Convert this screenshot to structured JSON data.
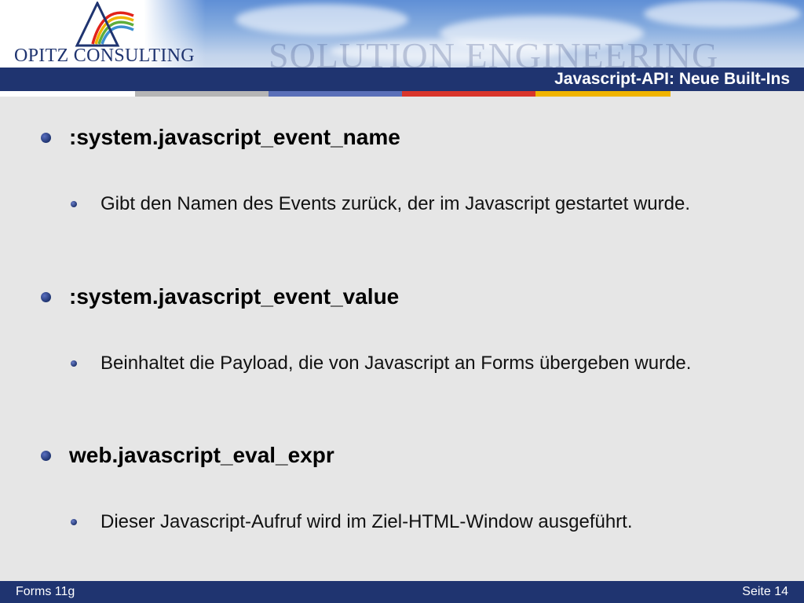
{
  "header": {
    "company_name": "OPITZ CONSULTING",
    "banner_text": "SOLUTION ENGINEERING",
    "slide_title": "Javascript-API: Neue Built-Ins"
  },
  "accent_colors": [
    "#1f3470",
    "#b5b5b5",
    "#5a6fb8",
    "#d9352b",
    "#f0b400"
  ],
  "content": {
    "items": [
      {
        "heading": ":system.javascript_event_name",
        "detail": "Gibt den Namen des Events zurück, der im Javascript gestartet wurde."
      },
      {
        "heading": ":system.javascript_event_value",
        "detail": "Beinhaltet die Payload, die von Javascript an Forms übergeben wurde."
      },
      {
        "heading": "web.javascript_eval_expr",
        "detail": "Dieser Javascript-Aufruf wird im Ziel-HTML-Window ausgeführt."
      }
    ]
  },
  "footer": {
    "left": "Forms 11g",
    "right": "Seite 14"
  }
}
